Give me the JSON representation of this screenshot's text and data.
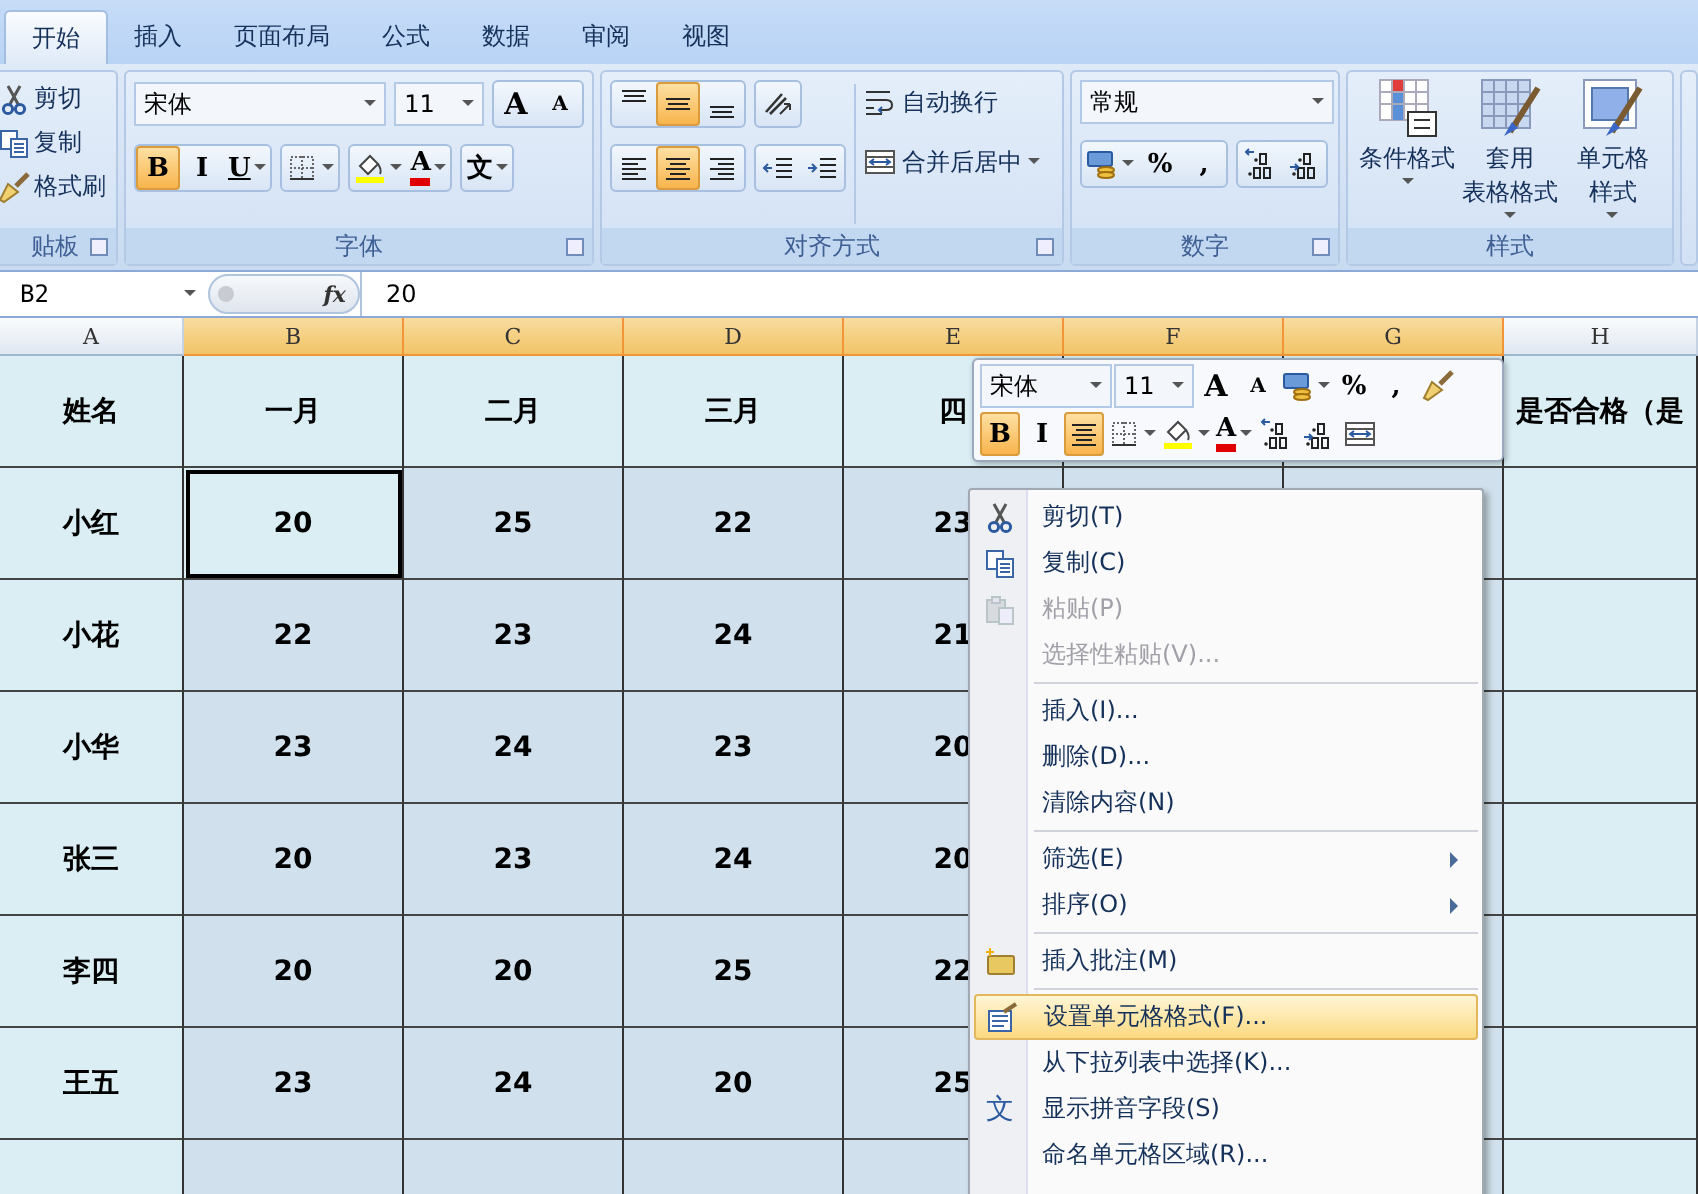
{
  "tabs": [
    {
      "label": "开始",
      "selected": true
    },
    {
      "label": "插入",
      "selected": false
    },
    {
      "label": "页面布局",
      "selected": false
    },
    {
      "label": "公式",
      "selected": false
    },
    {
      "label": "数据",
      "selected": false
    },
    {
      "label": "审阅",
      "selected": false
    },
    {
      "label": "视图",
      "selected": false
    }
  ],
  "ribbon": {
    "clipboard": {
      "title": "贴板",
      "items": [
        {
          "kind": "scissors",
          "label": "剪切"
        },
        {
          "kind": "copy",
          "label": "复制"
        },
        {
          "kind": "brush",
          "label": "格式刷"
        }
      ]
    },
    "font": {
      "title": "字体",
      "font_name": "宋体",
      "font_size": "11",
      "row1": [
        {
          "kind": "grow",
          "text": "A"
        },
        {
          "kind": "shrink",
          "text": "A"
        }
      ],
      "row2": [
        {
          "kind": "glyph",
          "text": "B",
          "selected": true
        },
        {
          "kind": "glyph",
          "text": "I",
          "selected": false
        },
        {
          "kind": "underline",
          "text": "U",
          "selected": false
        },
        {
          "kind": "border",
          "selected": false
        },
        {
          "kind": "fill",
          "selected": false
        },
        {
          "kind": "fontcolor",
          "text": "A",
          "selected": false
        },
        {
          "kind": "pinyin",
          "text": "文",
          "selected": false
        }
      ]
    },
    "alignment": {
      "title": "对齐方式",
      "row1": [
        {
          "kind": "align-top",
          "selected": false
        },
        {
          "kind": "align-middle",
          "selected": true
        },
        {
          "kind": "align-bottom",
          "selected": false
        },
        {
          "kind": "orientation",
          "selected": false
        }
      ],
      "row2": [
        {
          "kind": "align-left",
          "selected": false
        },
        {
          "kind": "align-center",
          "selected": true
        },
        {
          "kind": "align-right",
          "selected": false
        },
        {
          "kind": "indent-dec",
          "selected": false
        },
        {
          "kind": "indent-inc",
          "selected": false
        }
      ],
      "wrap": "自动换行",
      "merge": "合并后居中"
    },
    "number": {
      "title": "数字",
      "format": "常规",
      "buttons": [
        {
          "kind": "currency"
        },
        {
          "kind": "glyph",
          "text": "%"
        },
        {
          "kind": "glyph",
          "text": ","
        },
        {
          "kind": "dec-inc"
        },
        {
          "kind": "dec-dec"
        }
      ]
    },
    "styles": {
      "title": "样式",
      "items": [
        {
          "kind": "cond-format",
          "lines": [
            "条件格式"
          ]
        },
        {
          "kind": "table-format",
          "lines": [
            "套用",
            "表格格式"
          ]
        },
        {
          "kind": "cell-style",
          "lines": [
            "单元格",
            "样式"
          ]
        }
      ]
    }
  },
  "formula_bar": {
    "name_box": "B2",
    "fx": "fx",
    "value": "20"
  },
  "table": {
    "columns": [
      {
        "label": "A",
        "selected": false
      },
      {
        "label": "B",
        "selected": true
      },
      {
        "label": "C",
        "selected": true
      },
      {
        "label": "D",
        "selected": true
      },
      {
        "label": "E",
        "selected": true
      },
      {
        "label": "F",
        "selected": true
      },
      {
        "label": "G",
        "selected": true
      },
      {
        "label": "H",
        "selected": false
      }
    ],
    "header": [
      "姓名",
      "一月",
      "二月",
      "三月",
      "四"
    ],
    "header_h": "是否合格（是",
    "rows": [
      {
        "cells": [
          {
            "text": "小红",
            "active": false
          },
          {
            "text": "20",
            "active": true
          },
          {
            "text": "25",
            "active": false
          },
          {
            "text": "22",
            "active": false
          },
          {
            "text": "23",
            "active": false
          }
        ]
      },
      {
        "cells": [
          {
            "text": "小花",
            "active": false
          },
          {
            "text": "22",
            "active": false
          },
          {
            "text": "23",
            "active": false
          },
          {
            "text": "24",
            "active": false
          },
          {
            "text": "21",
            "active": false
          }
        ]
      },
      {
        "cells": [
          {
            "text": "小华",
            "active": false
          },
          {
            "text": "23",
            "active": false
          },
          {
            "text": "24",
            "active": false
          },
          {
            "text": "23",
            "active": false
          },
          {
            "text": "20",
            "active": false
          }
        ]
      },
      {
        "cells": [
          {
            "text": "张三",
            "active": false
          },
          {
            "text": "20",
            "active": false
          },
          {
            "text": "23",
            "active": false
          },
          {
            "text": "24",
            "active": false
          },
          {
            "text": "20",
            "active": false
          }
        ]
      },
      {
        "cells": [
          {
            "text": "李四",
            "active": false
          },
          {
            "text": "20",
            "active": false
          },
          {
            "text": "20",
            "active": false
          },
          {
            "text": "25",
            "active": false
          },
          {
            "text": "22",
            "active": false
          }
        ]
      },
      {
        "cells": [
          {
            "text": "王五",
            "active": false
          },
          {
            "text": "23",
            "active": false
          },
          {
            "text": "24",
            "active": false
          },
          {
            "text": "20",
            "active": false
          },
          {
            "text": "25",
            "active": false
          }
        ]
      }
    ]
  },
  "mini_toolbar": {
    "font_name": "宋体",
    "font_size": "11",
    "row1": [
      {
        "kind": "grow",
        "text": "A"
      },
      {
        "kind": "shrink",
        "text": "A"
      },
      {
        "kind": "currency"
      },
      {
        "kind": "glyph",
        "text": "%"
      },
      {
        "kind": "glyph",
        "text": ","
      },
      {
        "kind": "brush"
      }
    ],
    "row2": [
      {
        "kind": "glyph",
        "text": "B",
        "selected": true
      },
      {
        "kind": "glyph",
        "text": "I",
        "selected": false
      },
      {
        "kind": "align-center",
        "selected": true
      },
      {
        "kind": "border",
        "selected": false
      },
      {
        "kind": "fill",
        "selected": false
      },
      {
        "kind": "fontcolor",
        "text": "A",
        "selected": false
      },
      {
        "kind": "dec-inc",
        "selected": false
      },
      {
        "kind": "dec-dec",
        "selected": false
      },
      {
        "kind": "merge",
        "selected": false
      }
    ]
  },
  "context_menu": [
    {
      "label": "剪切(T)",
      "kind": "scissors",
      "disabled": false,
      "submenu": false,
      "highlighted": false,
      "separator_before": false
    },
    {
      "label": "复制(C)",
      "kind": "copy",
      "disabled": false,
      "submenu": false,
      "highlighted": false,
      "separator_before": false
    },
    {
      "label": "粘贴(P)",
      "kind": "paste",
      "disabled": true,
      "submenu": false,
      "highlighted": false,
      "separator_before": false
    },
    {
      "label": "选择性粘贴(V)...",
      "disabled": true,
      "submenu": false,
      "highlighted": false,
      "separator_before": false
    },
    {
      "label": "插入(I)...",
      "disabled": false,
      "submenu": false,
      "highlighted": false,
      "separator_before": true
    },
    {
      "label": "删除(D)...",
      "disabled": false,
      "submenu": false,
      "highlighted": false,
      "separator_before": false
    },
    {
      "label": "清除内容(N)",
      "disabled": false,
      "submenu": false,
      "highlighted": false,
      "separator_before": false
    },
    {
      "label": "筛选(E)",
      "disabled": false,
      "submenu": true,
      "highlighted": false,
      "separator_before": true
    },
    {
      "label": "排序(O)",
      "disabled": false,
      "submenu": true,
      "highlighted": false,
      "separator_before": false
    },
    {
      "label": "插入批注(M)",
      "kind": "comment",
      "disabled": false,
      "submenu": false,
      "highlighted": false,
      "separator_before": true
    },
    {
      "label": "设置单元格格式(F)...",
      "kind": "format-cells",
      "disabled": false,
      "submenu": false,
      "highlighted": true,
      "separator_before": true
    },
    {
      "label": "从下拉列表中选择(K)...",
      "disabled": false,
      "submenu": false,
      "highlighted": false,
      "separator_before": false
    },
    {
      "label": "显示拼音字段(S)",
      "kind": "pinyin",
      "icon_text": "文",
      "disabled": false,
      "submenu": false,
      "highlighted": false,
      "separator_before": false
    },
    {
      "label": "命名单元格区域(R)...",
      "disabled": false,
      "submenu": false,
      "highlighted": false,
      "separator_before": false
    }
  ]
}
